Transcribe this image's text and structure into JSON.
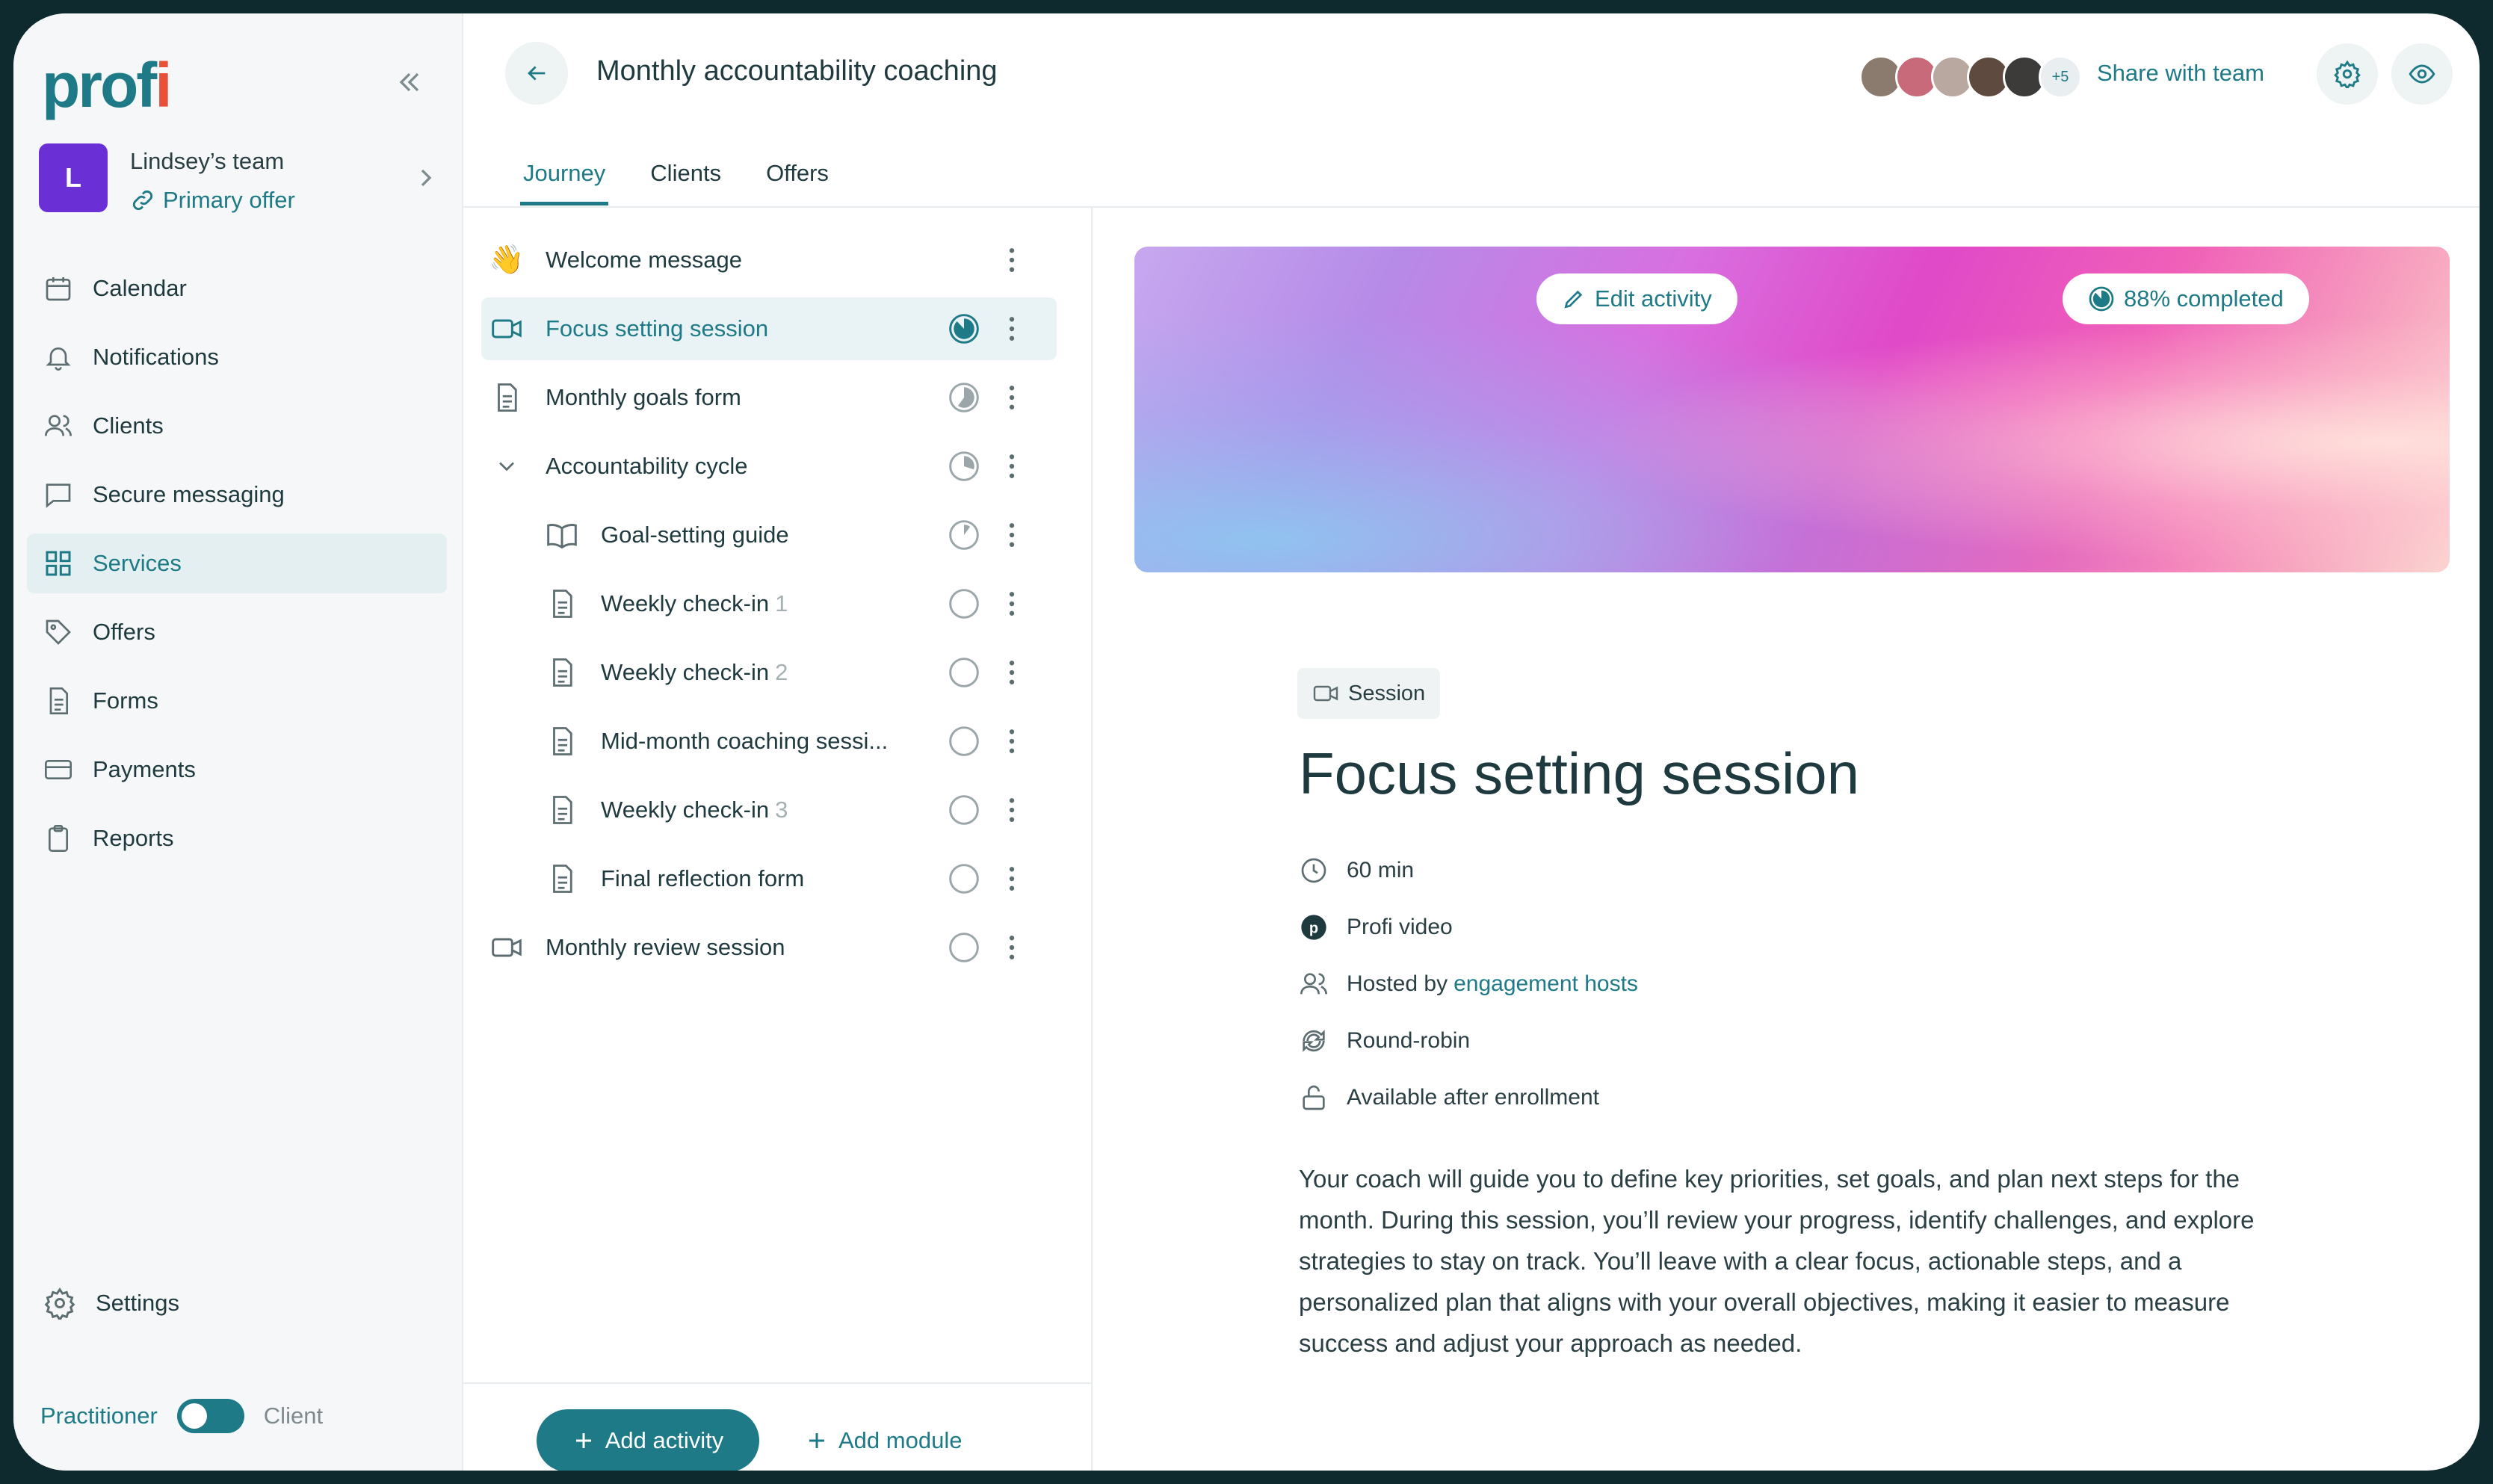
{
  "app": {
    "logo": "prof",
    "logo_dot": "i"
  },
  "team": {
    "initial": "L",
    "name": "Lindsey’s team",
    "offer": "Primary offer"
  },
  "nav": [
    {
      "label": "Calendar",
      "icon": "calendar-icon"
    },
    {
      "label": "Notifications",
      "icon": "bell-icon"
    },
    {
      "label": "Clients",
      "icon": "users-icon"
    },
    {
      "label": "Secure messaging",
      "icon": "chat-icon"
    },
    {
      "label": "Services",
      "icon": "grid-icon",
      "active": true
    },
    {
      "label": "Offers",
      "icon": "tag-icon"
    },
    {
      "label": "Forms",
      "icon": "document-icon"
    },
    {
      "label": "Payments",
      "icon": "card-icon"
    },
    {
      "label": "Reports",
      "icon": "clipboard-icon"
    }
  ],
  "settings_label": "Settings",
  "mode": {
    "left": "Practitioner",
    "right": "Client",
    "toggle_on": true
  },
  "header": {
    "title": "Monthly accountability coaching",
    "extra_members": "+5",
    "share_label": "Share with team"
  },
  "tabs": [
    "Journey",
    "Clients",
    "Offers"
  ],
  "journey": [
    {
      "label": "Welcome message",
      "num": "",
      "icon": "wave-emoji-icon",
      "progress": null
    },
    {
      "label": "Focus setting session",
      "num": "",
      "icon": "video-icon",
      "progress": 0.88,
      "active": true
    },
    {
      "label": "Monthly goals form",
      "num": "",
      "icon": "document-icon",
      "progress": 0.6
    },
    {
      "label": "Accountability cycle",
      "num": "",
      "icon": "chevron-down-icon",
      "progress": 0.3
    },
    {
      "label": "Goal-setting guide",
      "num": "",
      "icon": "book-icon",
      "progress": 0.1
    },
    {
      "label": "Weekly check-in",
      "num": "1",
      "icon": "document-icon",
      "progress": 0
    },
    {
      "label": "Weekly check-in",
      "num": "2",
      "icon": "document-icon",
      "progress": 0
    },
    {
      "label": "Mid-month coaching sessi...",
      "num": "",
      "icon": "document-icon",
      "progress": 0
    },
    {
      "label": "Weekly check-in",
      "num": "3",
      "icon": "document-icon",
      "progress": 0
    },
    {
      "label": "Final reflection form",
      "num": "",
      "icon": "document-icon",
      "progress": 0
    },
    {
      "label": "Monthly review session",
      "num": "",
      "icon": "video-icon",
      "progress": 0
    }
  ],
  "footer": {
    "add_activity": "Add activity",
    "add_module": "Add module"
  },
  "detail": {
    "edit_label": "Edit activity",
    "completed_label": "88% completed",
    "completed_fraction": 0.88,
    "chip": "Session",
    "title": "Focus setting session",
    "duration": "60 min",
    "platform": "Profi video",
    "hosted_prefix": "Hosted by",
    "hosted_link": "engagement hosts",
    "assignment": "Round-robin",
    "availability": "Available after enrollment",
    "description": "Your coach will guide you to define key priorities, set goals, and plan next steps for the month. During this session, you’ll review your progress, identify challenges, and explore strategies to stay on track. You’ll leave with a clear focus, actionable steps, and a personalized plan that aligns with your overall objectives, making it easier to measure success and adjust your approach as needed."
  },
  "colors": {
    "accent": "#1d7a86",
    "brand_purple": "#6b2fd6"
  }
}
